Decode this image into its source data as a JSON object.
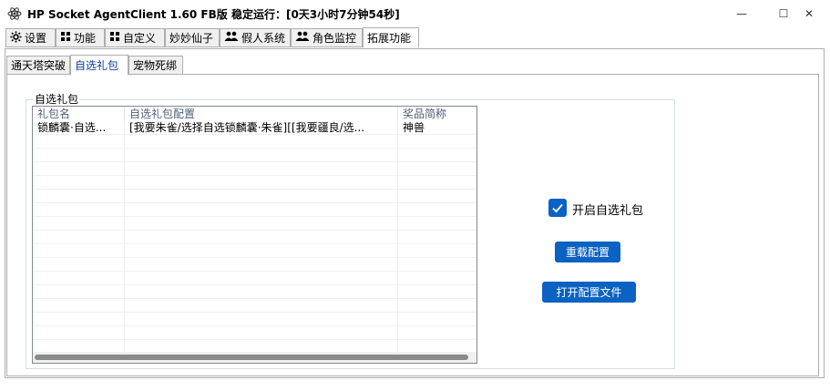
{
  "window": {
    "title": "HP Socket AgentClient 1.60 FB版 稳定运行：[0天3小时7分钟54秒]",
    "min_glyph": "—",
    "max_glyph": "☐",
    "close_glyph": "✕"
  },
  "main_tabs": [
    {
      "label": "设置",
      "icon": "gear-icon",
      "glyph": "✿"
    },
    {
      "label": "功能",
      "icon": "grid-icon",
      "glyph": "▪▪"
    },
    {
      "label": "自定义",
      "icon": "grid-icon",
      "glyph": "▪▪"
    },
    {
      "label": "妙妙仙子",
      "icon": "",
      "glyph": ""
    },
    {
      "label": "假人系统",
      "icon": "users-icon",
      "glyph": "👥"
    },
    {
      "label": "角色监控",
      "icon": "users-icon",
      "glyph": "👥"
    },
    {
      "label": "拓展功能",
      "icon": "",
      "glyph": "",
      "active": true
    }
  ],
  "sub_tabs": [
    {
      "label": "通天塔突破"
    },
    {
      "label": "自选礼包",
      "active": true
    },
    {
      "label": "宠物死绑"
    }
  ],
  "group": {
    "title": "自选礼包"
  },
  "table": {
    "columns": [
      "礼包名",
      "自选礼包配置",
      "奖品简称"
    ],
    "rows": [
      [
        "锁麟囊·自选...",
        "[我要朱雀/选择自选锁麟囊·朱雀][[我要疆良/选...",
        "神兽"
      ]
    ]
  },
  "options": {
    "enable_label": "开启自选礼包",
    "enabled": true,
    "reload_label": "重载配置",
    "open_file_label": "打开配置文件"
  },
  "colors": {
    "accent": "#0a62c2",
    "header_text": "#4c607a"
  }
}
